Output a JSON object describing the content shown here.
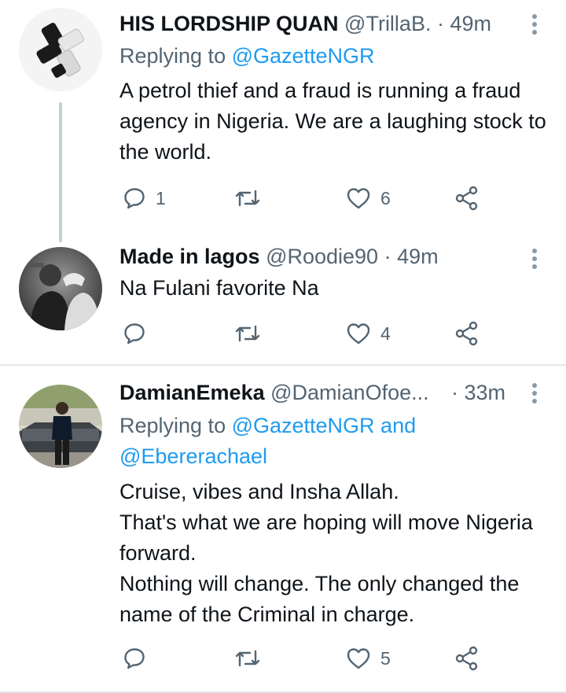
{
  "tweets": [
    {
      "name": "HIS LORDSHIP QUAN",
      "handle": "@TrillaB...",
      "sep": " · ",
      "time": "49m",
      "replying_prefix": "Replying to ",
      "replying_to": "@GazetteNGR",
      "text": "A petrol thief and a fraud is running a fraud agency in Nigeria. We are a laughing stock to the world.",
      "replies": "1",
      "likes": "6",
      "avatar_icon": "chess-knight-logo-icon"
    },
    {
      "name": "Made in lagos",
      "handle": "@Roodie90",
      "sep": " · ",
      "time": "49m",
      "text": "Na Fulani favorite Na",
      "likes": "4",
      "avatar_icon": "profile-photo"
    },
    {
      "name": "DamianEmeka",
      "handle": "@DamianOfoe...",
      "sep": "· ",
      "time": "33m",
      "replying_prefix": "Replying to ",
      "replying_to": "@GazetteNGR and",
      "replying_to_2": "@Ebererachael",
      "text_lines": [
        "Cruise, vibes and Insha Allah.",
        "That's what we are hoping will move Nigeria forward.",
        "Nothing will change. The only changed the name of the Criminal in charge."
      ],
      "likes": "5",
      "avatar_icon": "profile-photo"
    }
  ],
  "colors": {
    "text": "#0f1419",
    "secondary": "#536471",
    "link": "#1d9bf0",
    "thread_line": "#c4cfd6",
    "divider": "#e1e8ed"
  }
}
